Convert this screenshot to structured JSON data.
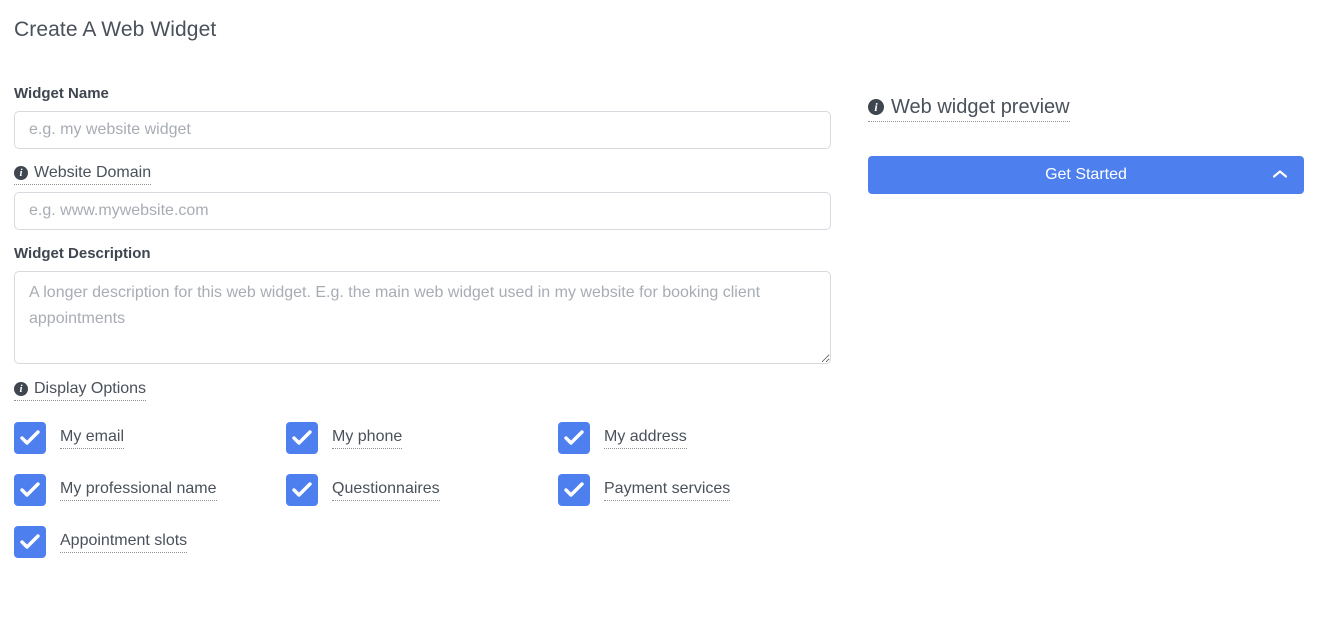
{
  "page": {
    "title": "Create A Web Widget"
  },
  "form": {
    "widget_name": {
      "label": "Widget Name",
      "placeholder": "e.g. my website widget",
      "value": ""
    },
    "website_domain": {
      "label": "Website Domain",
      "icon": "info-icon",
      "placeholder": "e.g. www.mywebsite.com",
      "value": ""
    },
    "widget_description": {
      "label": "Widget Description",
      "placeholder": "A longer description for this web widget. E.g. the main web widget used in my website for booking client appointments",
      "value": ""
    },
    "display_options": {
      "label": "Display Options",
      "icon": "info-icon",
      "items": [
        {
          "label": "My email",
          "checked": true
        },
        {
          "label": "My phone",
          "checked": true
        },
        {
          "label": "My address",
          "checked": true
        },
        {
          "label": "My professional name",
          "checked": true
        },
        {
          "label": "Questionnaires",
          "checked": true
        },
        {
          "label": "Payment services",
          "checked": true
        },
        {
          "label": "Appointment slots",
          "checked": true
        }
      ]
    }
  },
  "preview": {
    "title": "Web widget preview",
    "icon": "info-icon",
    "button": {
      "label": "Get Started",
      "icon": "chevron-up-icon"
    }
  },
  "colors": {
    "accent": "#4d7fee",
    "text": "#4a515a",
    "label": "#3f464f",
    "placeholder": "#a8acb3",
    "border": "#d6dadf"
  }
}
